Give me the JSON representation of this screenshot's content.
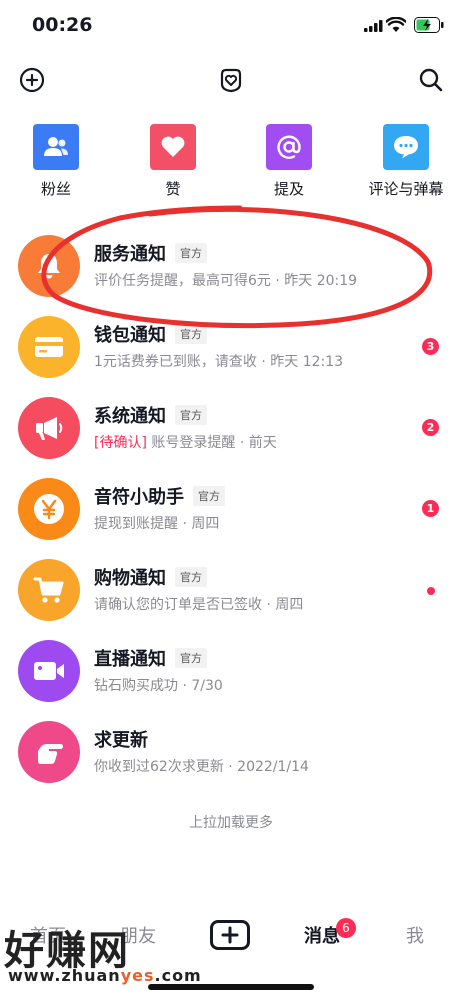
{
  "status_bar": {
    "time": "00:26"
  },
  "top_nav": {
    "left_icon": "add-friend-icon",
    "center_icon": "heart-badge-icon",
    "right_icon": "search-icon"
  },
  "quick_actions": [
    {
      "label": "粉丝",
      "icon": "fans-icon",
      "color": "#3b7cf5"
    },
    {
      "label": "赞",
      "icon": "heart-icon",
      "color": "#f25067"
    },
    {
      "label": "提及",
      "icon": "at-icon",
      "color": "#a24df2"
    },
    {
      "label": "评论与弹幕",
      "icon": "comment-icon",
      "color": "#33a7f2"
    }
  ],
  "messages": [
    {
      "title": "服务通知",
      "tag": "官方",
      "subtitle": "评价任务提醒，最高可得6元 · 昨天 20:19",
      "icon": "bell-icon",
      "color": "#f97b38"
    },
    {
      "title": "钱包通知",
      "tag": "官方",
      "subtitle": "1元话费券已到账，请查收 · 昨天 12:13",
      "badge": "3",
      "icon": "wallet-icon",
      "color": "#fbb32b"
    },
    {
      "title": "系统通知",
      "tag": "官方",
      "pending": "[待确认]",
      "subtitle": " 账号登录提醒 · 前天",
      "badge": "2",
      "icon": "megaphone-icon",
      "color": "#f54c5f"
    },
    {
      "title": "音符小助手",
      "tag": "官方",
      "subtitle": "提现到账提醒        · 周四",
      "badge": "1",
      "icon": "yen-icon",
      "color": "#f98a18"
    },
    {
      "title": "购物通知",
      "tag": "官方",
      "subtitle": "请确认您的订单是否已签收 · 周四",
      "dot": true,
      "icon": "cart-icon",
      "color": "#f9a52b"
    },
    {
      "title": "直播通知",
      "tag": "官方",
      "subtitle": "钻石购买成功 · 7/30",
      "icon": "video-icon",
      "color": "#9d4af0"
    },
    {
      "title": "求更新",
      "subtitle": "你收到过62次求更新 · 2022/1/14",
      "icon": "pointing-hand-icon",
      "color": "#f0498a"
    }
  ],
  "load_more": "上拉加载更多",
  "tabbar": {
    "home": "首页",
    "friends": "朋友",
    "messages": "消息",
    "messages_badge": "6",
    "me": "我"
  },
  "watermark": {
    "text": "好赚网",
    "url_prefix": "www.zhuan",
    "url_accent": "yes",
    "url_suffix": ".com"
  }
}
